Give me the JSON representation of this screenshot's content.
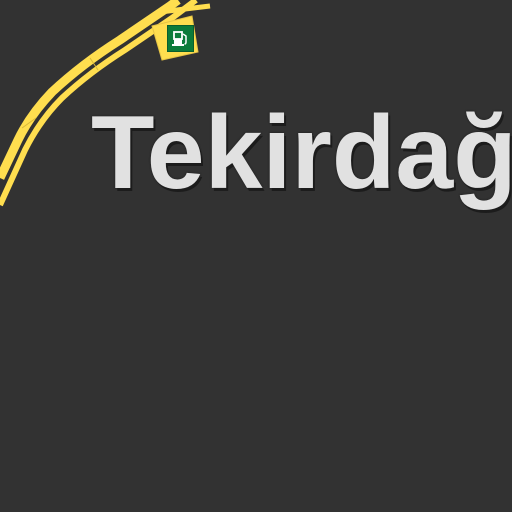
{
  "map": {
    "background_color": "#323232",
    "road_color": "#ffde4f",
    "road_casing_color": "#d9b83a",
    "place_label": {
      "text": "Tekirdağ",
      "color": "#e1e1e1"
    },
    "poi": {
      "icon": "fuel-station-icon",
      "color": "#0c7b3a"
    }
  }
}
